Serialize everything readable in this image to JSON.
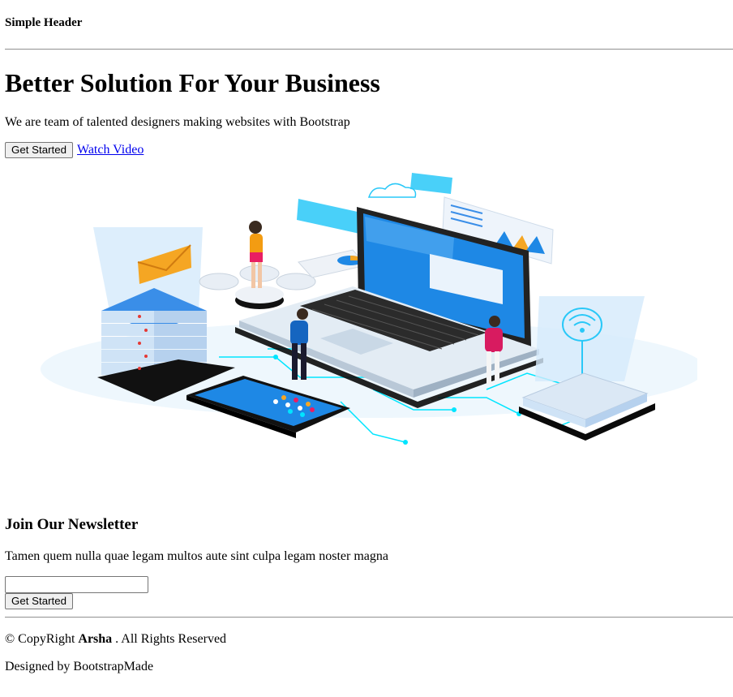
{
  "header": {
    "title": "Simple Header"
  },
  "hero": {
    "title": "Better Solution For Your Business",
    "subtitle": "We are team of talented designers making websites with Bootstrap",
    "primary_button": "Get Started",
    "video_link": "Watch Video"
  },
  "newsletter": {
    "title": "Join Our Newsletter",
    "text": "Tamen quem nulla quae legam multos aute sint culpa legam noster magna",
    "input_value": "",
    "button": "Get Started"
  },
  "footer": {
    "copyright_prefix": "© CopyRight ",
    "brand": "Arsha",
    "copyright_suffix": " . All Rights Reserved",
    "designed_by": "Designed by BootstrapMade"
  },
  "colors": {
    "link": "#0000ee",
    "illustration_primary": "#1e88e5",
    "illustration_cyan": "#00e5ff",
    "illustration_orange": "#f5a623"
  }
}
